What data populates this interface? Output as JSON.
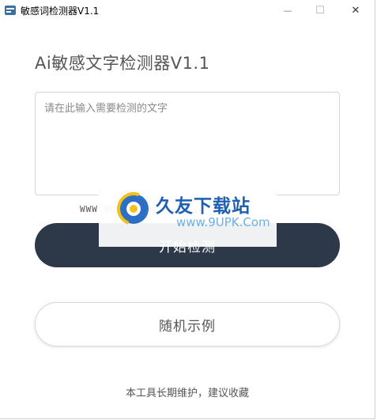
{
  "window": {
    "title": "敏感词检测器V1.1",
    "minimize_symbol": "—",
    "maximize_symbol": "☐",
    "close_symbol": "✕"
  },
  "main": {
    "heading": "Ai敏感文字检测器V1.1",
    "input_placeholder": "请在此输入需要检测的文字",
    "input_value": "",
    "start_button_label": "开始检测",
    "example_button_label": "随机示例",
    "footer_text": "本工具长期维护，建议收藏"
  },
  "watermark": {
    "title": "久友下载站",
    "url": "www.9UPK.Com",
    "url_left": "WWW.9UPK.COM"
  },
  "colors": {
    "primary_button": "#2d3949",
    "watermark_blue": "#1e5fb0"
  },
  "icons": {
    "app": "app-icon",
    "watermark_logo": "globe-logo-icon"
  }
}
